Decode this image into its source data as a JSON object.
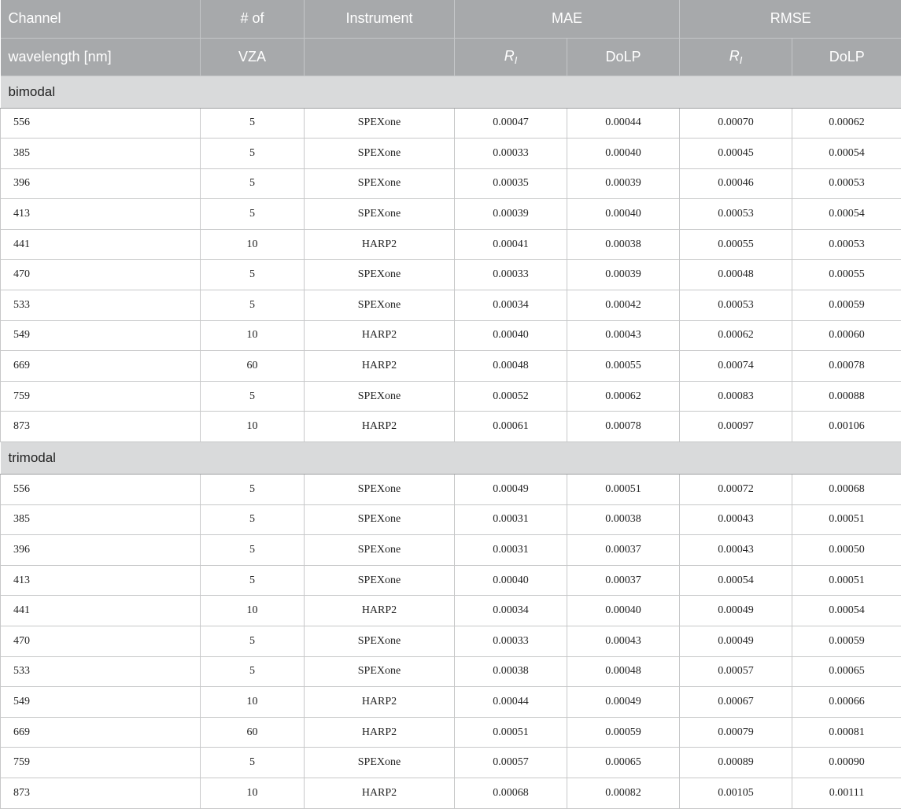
{
  "headers": {
    "row1": [
      "Channel",
      "# of",
      "Instrument",
      "MAE",
      "RMSE"
    ],
    "row2": {
      "col1": "wavelength [nm]",
      "col2": "VZA",
      "col3": "",
      "mae_ri_main": "R",
      "mae_ri_sub": "I",
      "mae_dolp": "DoLP",
      "rmse_ri_main": "R",
      "rmse_ri_sub": "I",
      "rmse_dolp": "DoLP"
    }
  },
  "groups": [
    {
      "label": "bimodal",
      "rows": [
        [
          "556",
          "5",
          "SPEXone",
          "0.00047",
          "0.00044",
          "0.00070",
          "0.00062"
        ],
        [
          "385",
          "5",
          "SPEXone",
          "0.00033",
          "0.00040",
          "0.00045",
          "0.00054"
        ],
        [
          "396",
          "5",
          "SPEXone",
          "0.00035",
          "0.00039",
          "0.00046",
          "0.00053"
        ],
        [
          "413",
          "5",
          "SPEXone",
          "0.00039",
          "0.00040",
          "0.00053",
          "0.00054"
        ],
        [
          "441",
          "10",
          "HARP2",
          "0.00041",
          "0.00038",
          "0.00055",
          "0.00053"
        ],
        [
          "470",
          "5",
          "SPEXone",
          "0.00033",
          "0.00039",
          "0.00048",
          "0.00055"
        ],
        [
          "533",
          "5",
          "SPEXone",
          "0.00034",
          "0.00042",
          "0.00053",
          "0.00059"
        ],
        [
          "549",
          "10",
          "HARP2",
          "0.00040",
          "0.00043",
          "0.00062",
          "0.00060"
        ],
        [
          "669",
          "60",
          "HARP2",
          "0.00048",
          "0.00055",
          "0.00074",
          "0.00078"
        ],
        [
          "759",
          "5",
          "SPEXone",
          "0.00052",
          "0.00062",
          "0.00083",
          "0.00088"
        ],
        [
          "873",
          "10",
          "HARP2",
          "0.00061",
          "0.00078",
          "0.00097",
          "0.00106"
        ]
      ]
    },
    {
      "label": "trimodal",
      "rows": [
        [
          "556",
          "5",
          "SPEXone",
          "0.00049",
          "0.00051",
          "0.00072",
          "0.00068"
        ],
        [
          "385",
          "5",
          "SPEXone",
          "0.00031",
          "0.00038",
          "0.00043",
          "0.00051"
        ],
        [
          "396",
          "5",
          "SPEXone",
          "0.00031",
          "0.00037",
          "0.00043",
          "0.00050"
        ],
        [
          "413",
          "5",
          "SPEXone",
          "0.00040",
          "0.00037",
          "0.00054",
          "0.00051"
        ],
        [
          "441",
          "10",
          "HARP2",
          "0.00034",
          "0.00040",
          "0.00049",
          "0.00054"
        ],
        [
          "470",
          "5",
          "SPEXone",
          "0.00033",
          "0.00043",
          "0.00049",
          "0.00059"
        ],
        [
          "533",
          "5",
          "SPEXone",
          "0.00038",
          "0.00048",
          "0.00057",
          "0.00065"
        ],
        [
          "549",
          "10",
          "HARP2",
          "0.00044",
          "0.00049",
          "0.00067",
          "0.00066"
        ],
        [
          "669",
          "60",
          "HARP2",
          "0.00051",
          "0.00059",
          "0.00079",
          "0.00081"
        ],
        [
          "759",
          "5",
          "SPEXone",
          "0.00057",
          "0.00065",
          "0.00089",
          "0.00090"
        ],
        [
          "873",
          "10",
          "HARP2",
          "0.00068",
          "0.00082",
          "0.00105",
          "0.00111"
        ]
      ]
    }
  ]
}
